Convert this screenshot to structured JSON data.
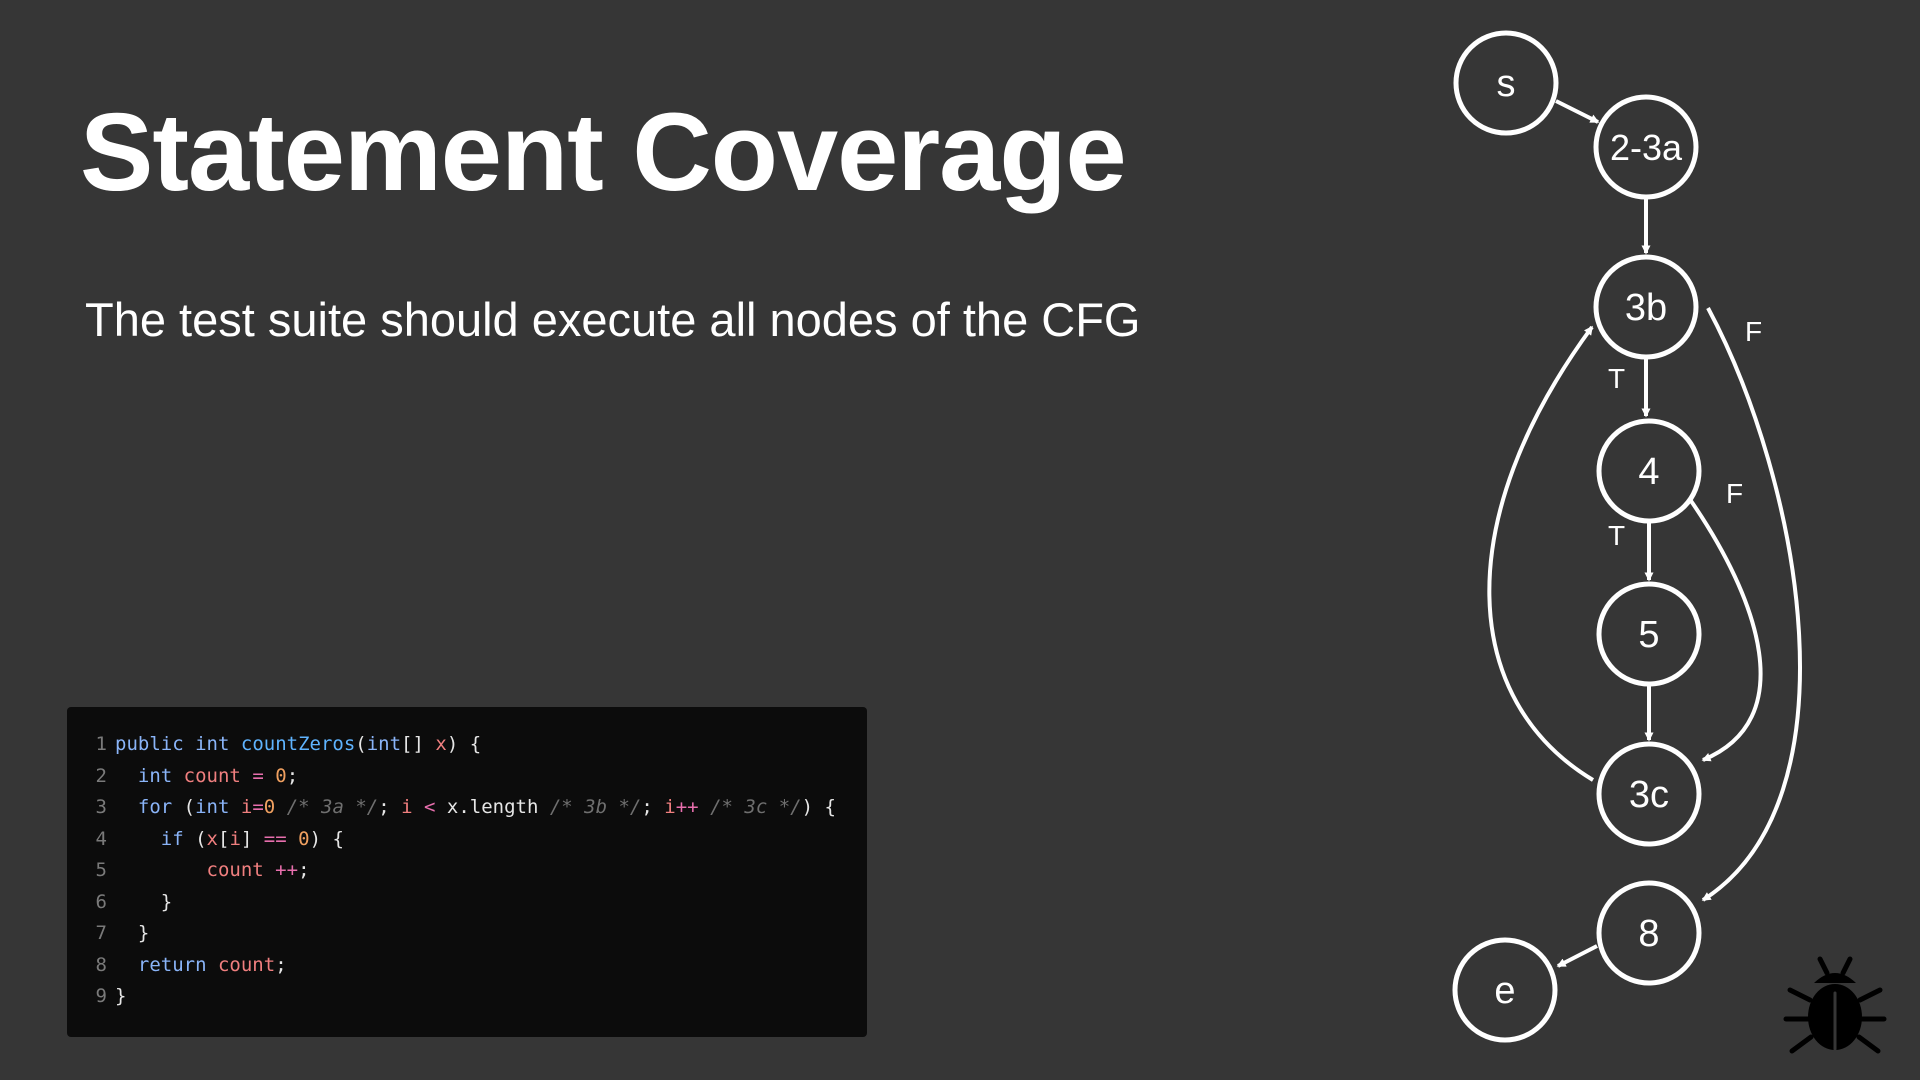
{
  "slide": {
    "title": "Statement Coverage",
    "subtitle": "The test suite should execute all nodes of the CFG"
  },
  "code": {
    "lines": [
      {
        "n": "1",
        "tokens": [
          {
            "t": "public",
            "c": "kw"
          },
          {
            "t": " "
          },
          {
            "t": "int",
            "c": "kw"
          },
          {
            "t": " "
          },
          {
            "t": "countZeros",
            "c": "fn"
          },
          {
            "t": "("
          },
          {
            "t": "int",
            "c": "kw"
          },
          {
            "t": "[] "
          },
          {
            "t": "x",
            "c": "var"
          },
          {
            "t": ") {"
          }
        ]
      },
      {
        "n": "2",
        "tokens": [
          {
            "t": "  "
          },
          {
            "t": "int",
            "c": "kw"
          },
          {
            "t": " "
          },
          {
            "t": "count",
            "c": "var"
          },
          {
            "t": " "
          },
          {
            "t": "=",
            "c": "op"
          },
          {
            "t": " "
          },
          {
            "t": "0",
            "c": "num"
          },
          {
            "t": ";"
          }
        ]
      },
      {
        "n": "3",
        "tokens": [
          {
            "t": "  "
          },
          {
            "t": "for",
            "c": "kw"
          },
          {
            "t": " ("
          },
          {
            "t": "int",
            "c": "kw"
          },
          {
            "t": " "
          },
          {
            "t": "i",
            "c": "var"
          },
          {
            "t": "=",
            "c": "op"
          },
          {
            "t": "0",
            "c": "num"
          },
          {
            "t": " "
          },
          {
            "t": "/* 3a */",
            "c": "cm"
          },
          {
            "t": "; "
          },
          {
            "t": "i",
            "c": "var"
          },
          {
            "t": " "
          },
          {
            "t": "<",
            "c": "op"
          },
          {
            "t": " x.length "
          },
          {
            "t": "/* 3b */",
            "c": "cm"
          },
          {
            "t": "; "
          },
          {
            "t": "i",
            "c": "var"
          },
          {
            "t": "++",
            "c": "op"
          },
          {
            "t": " "
          },
          {
            "t": "/* 3c */",
            "c": "cm"
          },
          {
            "t": ") {"
          }
        ]
      },
      {
        "n": "4",
        "tokens": [
          {
            "t": "    "
          },
          {
            "t": "if",
            "c": "kw"
          },
          {
            "t": " ("
          },
          {
            "t": "x",
            "c": "var"
          },
          {
            "t": "["
          },
          {
            "t": "i",
            "c": "var"
          },
          {
            "t": "] "
          },
          {
            "t": "==",
            "c": "op"
          },
          {
            "t": " "
          },
          {
            "t": "0",
            "c": "num"
          },
          {
            "t": ") {"
          }
        ]
      },
      {
        "n": "5",
        "tokens": [
          {
            "t": "        "
          },
          {
            "t": "count",
            "c": "var"
          },
          {
            "t": " "
          },
          {
            "t": "++",
            "c": "op"
          },
          {
            "t": ";"
          }
        ]
      },
      {
        "n": "6",
        "tokens": [
          {
            "t": "    }"
          }
        ]
      },
      {
        "n": "7",
        "tokens": [
          {
            "t": "  }"
          }
        ]
      },
      {
        "n": "8",
        "tokens": [
          {
            "t": "  "
          },
          {
            "t": "return",
            "c": "kw"
          },
          {
            "t": " "
          },
          {
            "t": "count",
            "c": "var"
          },
          {
            "t": ";"
          }
        ]
      },
      {
        "n": "9",
        "tokens": [
          {
            "t": "}"
          }
        ]
      }
    ]
  },
  "cfg": {
    "nodes": [
      {
        "id": "s",
        "label": "s"
      },
      {
        "id": "2-3a",
        "label": "2-3a"
      },
      {
        "id": "3b",
        "label": "3b"
      },
      {
        "id": "4",
        "label": "4"
      },
      {
        "id": "5",
        "label": "5"
      },
      {
        "id": "3c",
        "label": "3c"
      },
      {
        "id": "8",
        "label": "8"
      },
      {
        "id": "e",
        "label": "e"
      }
    ],
    "edges": [
      {
        "from": "s",
        "to": "2-3a",
        "label": ""
      },
      {
        "from": "2-3a",
        "to": "3b",
        "label": ""
      },
      {
        "from": "3b",
        "to": "4",
        "label": "T"
      },
      {
        "from": "4",
        "to": "5",
        "label": "T"
      },
      {
        "from": "5",
        "to": "3c",
        "label": ""
      },
      {
        "from": "4",
        "to": "3c",
        "label": "F"
      },
      {
        "from": "3c",
        "to": "3b",
        "label": ""
      },
      {
        "from": "3b",
        "to": "8",
        "label": "F"
      },
      {
        "from": "8",
        "to": "e",
        "label": ""
      }
    ]
  },
  "icons": {
    "logo": "bug-icon"
  },
  "colors": {
    "background": "#363636",
    "code_background": "#0c0c0c",
    "foreground": "#ffffff"
  }
}
